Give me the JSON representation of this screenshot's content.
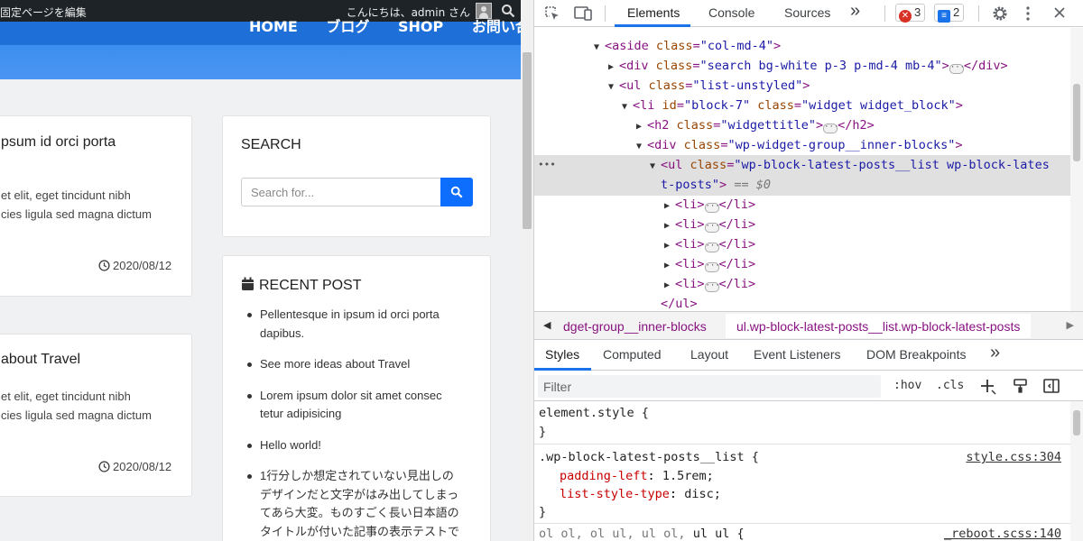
{
  "site": {
    "admin_left": "固定ページを編集",
    "admin_right": "こんにちは、admin さん",
    "nav": [
      "HOME",
      "ブログ",
      "SHOP",
      "お問い合わせ"
    ],
    "posts": [
      {
        "title": "psum id orci porta",
        "excerpt": [
          "et elit, eget tincidunt nibh",
          "cies ligula sed magna dictum"
        ],
        "date": "2020/08/12"
      },
      {
        "title": "about Travel",
        "excerpt": [
          "et elit, eget tincidunt nibh",
          "cies ligula sed magna dictum"
        ],
        "date": "2020/08/12"
      }
    ],
    "search": {
      "heading": "SEARCH",
      "placeholder": "Search for..."
    },
    "recent": {
      "heading": "RECENT POST",
      "items": [
        [
          "Pellentesque in ipsum id orci porta",
          "dapibus."
        ],
        [
          "See more ideas about Travel"
        ],
        [
          "Lorem ipsum dolor sit amet consec",
          "tetur adipisicing"
        ],
        [
          "Hello world!"
        ],
        [
          "1行分しか想定されていない見出しの",
          "デザインだと文字がはみ出してしまっ",
          "てあら大変。ものすごく長い日本語の",
          "タイトルが付いた記事の表示テストで"
        ]
      ]
    }
  },
  "devtools": {
    "tabs": [
      "Elements",
      "Console",
      "Sources"
    ],
    "more": "»",
    "errors": "3",
    "messages": "2",
    "dom": {
      "aside": {
        "tag": "aside",
        "attr": "class",
        "val": "\"col-md-4\""
      },
      "div_search": {
        "tag": "div",
        "attr": "class",
        "val": "\"search bg-white p-3 p-md-4 mb-4\"",
        "close": "</div>"
      },
      "ul": {
        "tag": "ul",
        "attr": "class",
        "val": "\"list-unstyled\""
      },
      "li": {
        "tag": "li",
        "attr1": "id",
        "val1": "\"block-7\"",
        "attr2": "class",
        "val2": "\"widget widget_block\""
      },
      "h2": {
        "tag": "h2",
        "attr": "class",
        "val": "\"widgettitle\"",
        "close": "</h2>"
      },
      "div_inner": {
        "tag": "div",
        "attr": "class",
        "val": "\"wp-widget-group__inner-blocks\""
      },
      "ul_sel": {
        "tag": "ul",
        "attr": "class",
        "val1": "\"wp-block-latest-posts__list wp-block-lates",
        "val2": "t-posts\"",
        "eq": "== $0"
      },
      "li_item": "<li>",
      "li_close": "</li>",
      "ul_close": "</ul>"
    },
    "breadcrumbs": [
      "dget-group__inner-blocks",
      "ul.wp-block-latest-posts__list.wp-block-latest-posts"
    ],
    "style_tabs": [
      "Styles",
      "Computed",
      "Layout",
      "Event Listeners",
      "DOM Breakpoints"
    ],
    "filter_placeholder": "Filter",
    "hov": ":hov",
    "cls": ".cls",
    "rules": {
      "r0": {
        "selector": "element.style {",
        "close": "}"
      },
      "r1": {
        "selector": ".wp-block-latest-posts__list {",
        "source": "style.css:304",
        "props": [
          {
            "name": "padding-left",
            "value": "1.5rem;"
          },
          {
            "name": "list-style-type",
            "value": "disc;"
          }
        ],
        "close": "}"
      },
      "r2": {
        "selector": "ol ol, ol ul, ul ol, ",
        "selector_bold": "ul ul",
        "selector_end": " {",
        "source": "_reboot.scss:140"
      }
    }
  }
}
